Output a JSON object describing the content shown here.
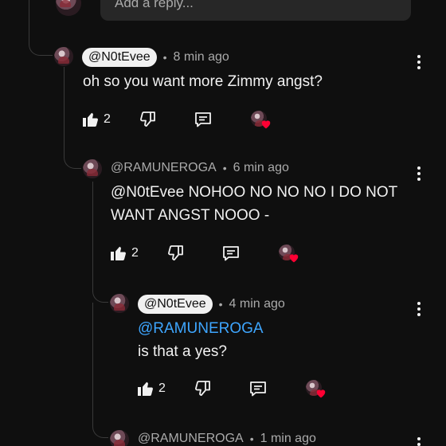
{
  "reply_box": {
    "placeholder": "Add a reply..."
  },
  "comments": [
    {
      "handle": "@N0tEvee",
      "time": "8 min ago",
      "lines": [
        "oh so you want more Zimmy angst?"
      ],
      "likes": "2"
    },
    {
      "handle": "@RAMUNEROGA",
      "time": "6 min ago",
      "lines": [
        "@N0tEvee NOHOO NO NO NO I DO NOT",
        "WANT ANGST NOOO -"
      ],
      "likes": "2"
    },
    {
      "handle": "@N0tEvee",
      "time": "4 min ago",
      "mention": "@RAMUNEROGA",
      "lines": [
        "is that a yes?"
      ],
      "likes": "2"
    },
    {
      "handle": "@RAMUNEROGA",
      "time": "1 min ago"
    }
  ],
  "separator": "•",
  "icons": {
    "like": "thumbs-up-icon",
    "dislike": "thumbs-down-icon",
    "reply": "reply-comment-icon",
    "more": "more-vert-icon",
    "creator_heart": "creator-heart-icon"
  },
  "colors": {
    "background": "#0f0f0f",
    "text": "#f1f1f1",
    "muted": "#aaaaaa",
    "mention": "#3ea6ff",
    "heart": "#ff0033"
  }
}
